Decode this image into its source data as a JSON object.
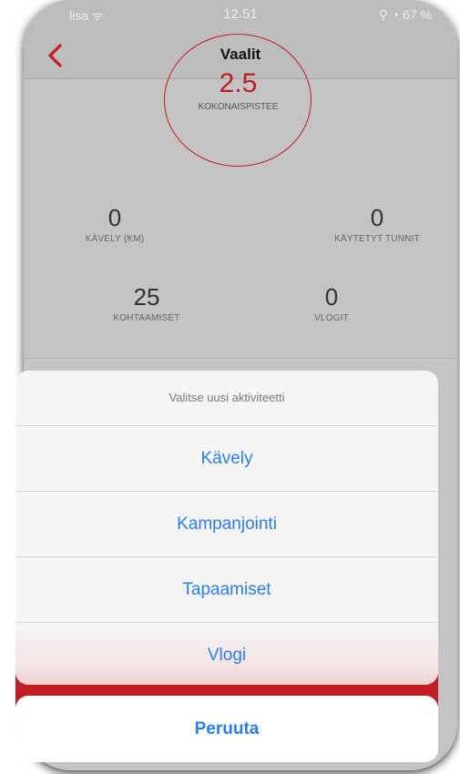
{
  "status": {
    "carrier": "lisa ᯤ",
    "time": "12.51",
    "right": "⚲ ◔ 67 %"
  },
  "nav": {
    "title": "Vaalit"
  },
  "summary": {
    "score": "2.5",
    "score_label": "KOKONAISPISTEE"
  },
  "stats": [
    {
      "value": "0",
      "label": "KÄVELY (KM)"
    },
    {
      "value": "0",
      "label": "KÄYTETYT TUNNIT"
    },
    {
      "value": "25",
      "label": "KOHTAAMISET"
    },
    {
      "value": "0",
      "label": "VLOGIT"
    }
  ],
  "sheet": {
    "title": "Valitse uusi aktiviteetti",
    "options": [
      "Kävely",
      "Kampanjointi",
      "Tapaamiset",
      "Vlogi"
    ],
    "cancel": "Peruuta"
  },
  "colors": {
    "accent": "#c11b24",
    "action_blue": "#2a7ef0"
  }
}
